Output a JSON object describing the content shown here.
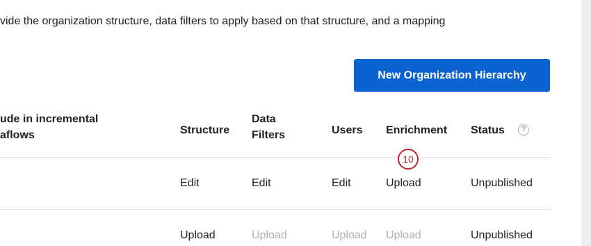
{
  "intro_text": "vide the organization structure, data filters to apply based on that structure, and a mapping",
  "new_hierarchy_button": "New Organization Hierarchy",
  "columns": {
    "include_line1": "ude in incremental",
    "include_line2": "aflows",
    "structure": "Structure",
    "data_filters_line1": "Data",
    "data_filters_line2": "Filters",
    "users": "Users",
    "enrichment": "Enrichment",
    "status": "Status",
    "status_help_icon": "?"
  },
  "step_badge": "10",
  "rows": [
    {
      "structure": "Edit",
      "data_filters": "Edit",
      "users": "Edit",
      "enrichment": "Upload",
      "status": "Unpublished"
    },
    {
      "structure": "Upload",
      "data_filters": "Upload",
      "users": "Upload",
      "enrichment": "Upload",
      "status": "Unpublished"
    }
  ],
  "colors": {
    "primary": "#0b63d1",
    "badge": "#c0262d",
    "disabled_text": "#b1b1b1"
  }
}
